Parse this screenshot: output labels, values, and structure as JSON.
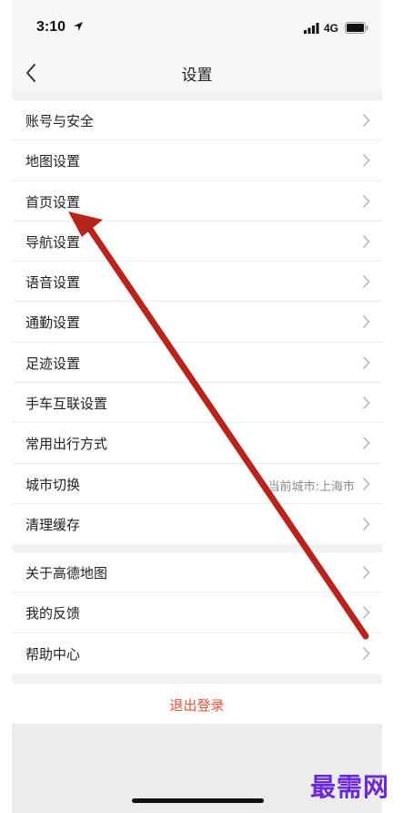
{
  "status": {
    "time": "3:10",
    "network": "4G"
  },
  "nav": {
    "title": "设置"
  },
  "group1": [
    {
      "label": "账号与安全"
    },
    {
      "label": "地图设置"
    },
    {
      "label": "首页设置"
    },
    {
      "label": "导航设置"
    },
    {
      "label": "语音设置"
    },
    {
      "label": "通勤设置"
    },
    {
      "label": "足迹设置"
    },
    {
      "label": "手车互联设置"
    },
    {
      "label": "常用出行方式"
    },
    {
      "label": "城市切换",
      "value": "当前城市:上海市"
    },
    {
      "label": "清理缓存"
    }
  ],
  "group2": [
    {
      "label": "关于高德地图"
    },
    {
      "label": "我的反馈"
    },
    {
      "label": "帮助中心"
    }
  ],
  "logout_label": "退出登录",
  "watermark": "最需网",
  "colors": {
    "annotation_arrow": "#b8231c",
    "logout": "#e5533c",
    "watermark": "#6a2bd6"
  }
}
